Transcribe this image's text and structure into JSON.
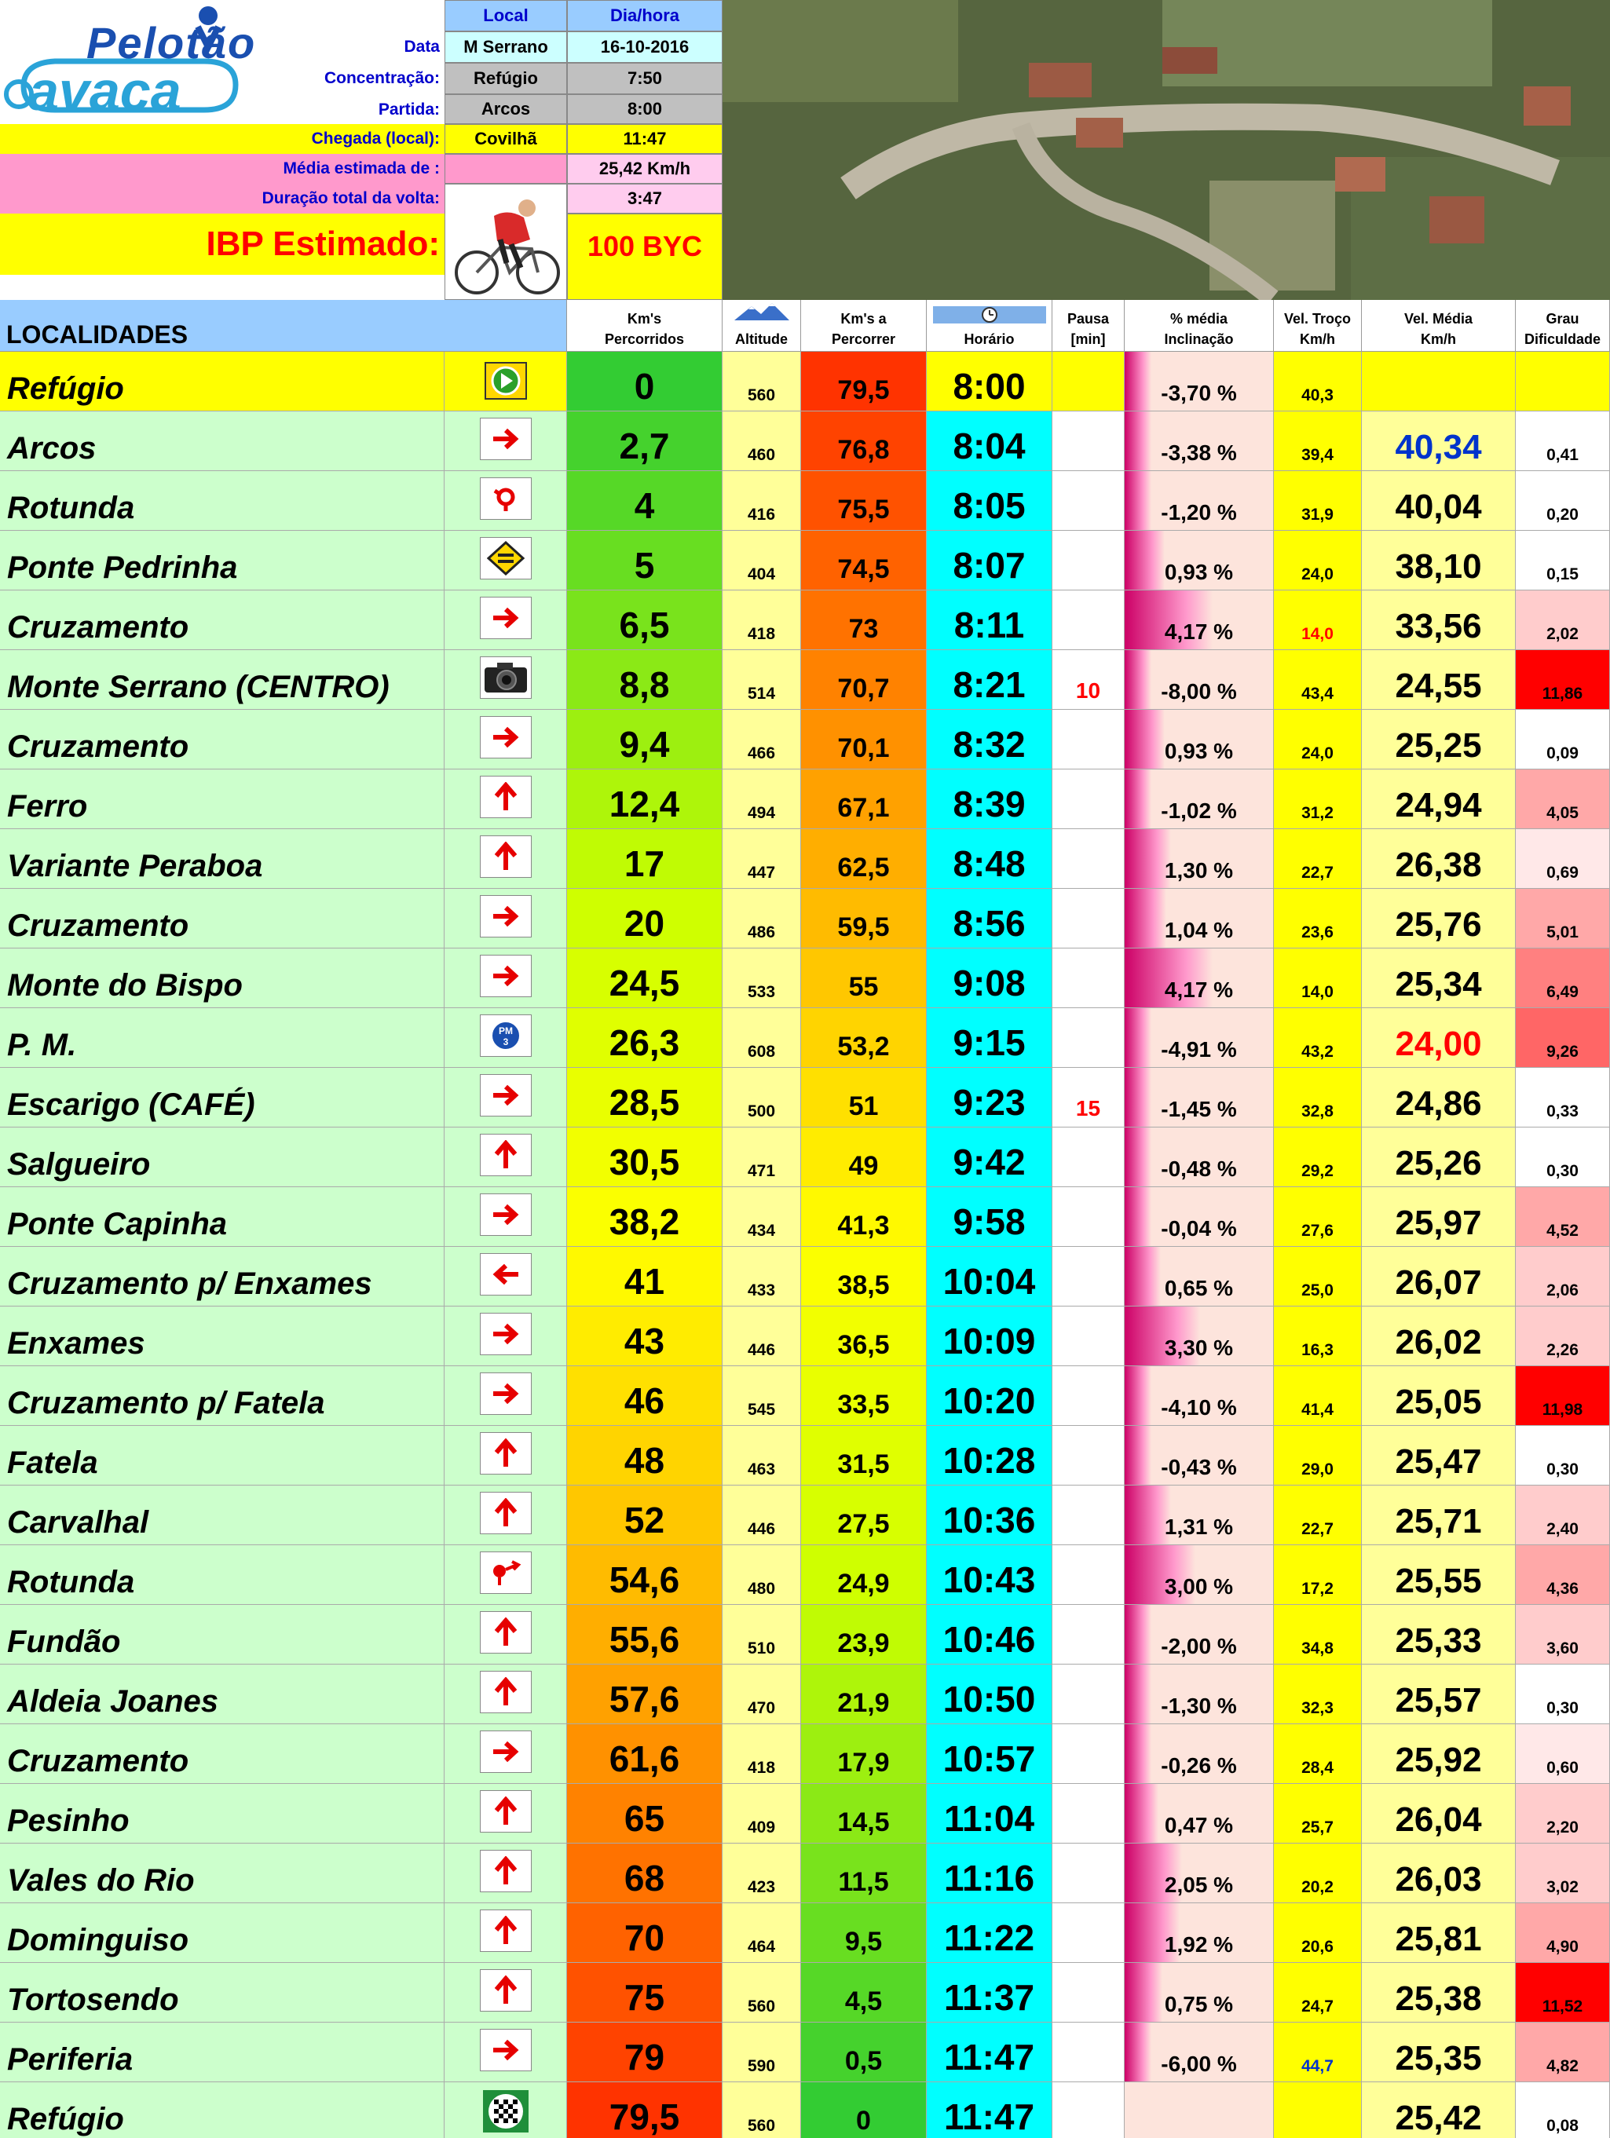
{
  "logo": {
    "line1": "Pelotão",
    "line2": "avaca"
  },
  "header": {
    "col_local": "Local",
    "col_diahora": "Dia/hora",
    "data_label": "Data",
    "data_local": "M Serrano",
    "data_date": "16-10-2016",
    "concentracao_label": "Concentração:",
    "concentracao_local": "Refúgio",
    "concentracao_hora": "7:50",
    "partida_label": "Partida:",
    "partida_local": "Arcos",
    "partida_hora": "8:00",
    "chegada_label": "Chegada (local):",
    "chegada_local": "Covilhã",
    "chegada_hora": "11:47",
    "media_label": "Média estimada de :",
    "media_value": "25,42 Km/h",
    "duracao_label": "Duração total da volta:",
    "duracao_value": "3:47",
    "ibp_label": "IBP Estimado:",
    "ibp_value": "100 BYC"
  },
  "columns": {
    "localidades": "LOCALIDADES",
    "kms_percorridos_1": "Km's",
    "kms_percorridos_2": "Percorridos",
    "altitude": "Altitude",
    "kms_percorrer_1": "Km's a",
    "kms_percorrer_2": "Percorrer",
    "horario": "Horário",
    "pausa_1": "Pausa",
    "pausa_2": "[min]",
    "inclinacao_1": "% média",
    "inclinacao_2": "Inclinação",
    "vel_troco_1": "Vel. Troço",
    "vel_troco_2": "Km/h",
    "vel_media_1": "Vel. Média",
    "vel_media_2": "Km/h",
    "grau_1": "Grau",
    "grau_2": "Dificuldade"
  },
  "rows": [
    {
      "name": "Refúgio",
      "icon": "start-icon",
      "km": "0",
      "alt": "560",
      "rest": "79,5",
      "time": "8:00",
      "pause": "",
      "incl": "-3,70 %",
      "incl_fill": 0.0,
      "vt": "40,3",
      "vm": "",
      "grau": ""
    },
    {
      "name": "Arcos",
      "icon": "arrow-right-icon",
      "km": "2,7",
      "alt": "460",
      "rest": "76,8",
      "time": "8:04",
      "pause": "",
      "incl": "-3,38 %",
      "incl_fill": 0.0,
      "vt": "39,4",
      "vm": "40,34",
      "grau": "0,41"
    },
    {
      "name": "Rotunda",
      "icon": "roundabout-icon",
      "km": "4",
      "alt": "416",
      "rest": "75,5",
      "time": "8:05",
      "pause": "",
      "incl": "-1,20 %",
      "incl_fill": 0.0,
      "vt": "31,9",
      "vm": "40,04",
      "grau": "0,20"
    },
    {
      "name": "Ponte Pedrinha",
      "icon": "narrow-bridge-icon",
      "km": "5",
      "alt": "404",
      "rest": "74,5",
      "time": "8:07",
      "pause": "",
      "incl": "0,93 %",
      "incl_fill": 0.11,
      "vt": "24,0",
      "vm": "38,10",
      "grau": "0,15"
    },
    {
      "name": "Cruzamento",
      "icon": "arrow-right-icon",
      "km": "6,5",
      "alt": "418",
      "rest": "73",
      "time": "8:11",
      "pause": "",
      "incl": "4,17 %",
      "incl_fill": 0.5,
      "vt": "14,0",
      "vm": "33,56",
      "grau": "2,02"
    },
    {
      "name": "Monte Serrano (CENTRO)",
      "icon": "camera-icon",
      "km": "8,8",
      "alt": "514",
      "rest": "70,7",
      "time": "8:21",
      "pause": "10",
      "incl": "-8,00 %",
      "incl_fill": 0.0,
      "vt": "43,4",
      "vm": "24,55",
      "grau": "11,86"
    },
    {
      "name": "Cruzamento",
      "icon": "arrow-right-icon",
      "km": "9,4",
      "alt": "466",
      "rest": "70,1",
      "time": "8:32",
      "pause": "",
      "incl": "0,93 %",
      "incl_fill": 0.11,
      "vt": "24,0",
      "vm": "25,25",
      "grau": "0,09"
    },
    {
      "name": "Ferro",
      "icon": "arrow-up-icon",
      "km": "12,4",
      "alt": "494",
      "rest": "67,1",
      "time": "8:39",
      "pause": "",
      "incl": "-1,02 %",
      "incl_fill": 0.0,
      "vt": "31,2",
      "vm": "24,94",
      "grau": "4,05"
    },
    {
      "name": "Variante Peraboa",
      "icon": "arrow-up-icon",
      "km": "17",
      "alt": "447",
      "rest": "62,5",
      "time": "8:48",
      "pause": "",
      "incl": "1,30 %",
      "incl_fill": 0.16,
      "vt": "22,7",
      "vm": "26,38",
      "grau": "0,69"
    },
    {
      "name": "Cruzamento",
      "icon": "arrow-right-icon",
      "km": "20",
      "alt": "486",
      "rest": "59,5",
      "time": "8:56",
      "pause": "",
      "incl": "1,04 %",
      "incl_fill": 0.12,
      "vt": "23,6",
      "vm": "25,76",
      "grau": "5,01"
    },
    {
      "name": "Monte do Bispo",
      "icon": "arrow-right-icon",
      "km": "24,5",
      "alt": "533",
      "rest": "55",
      "time": "9:08",
      "pause": "",
      "incl": "4,17 %",
      "incl_fill": 0.5,
      "vt": "14,0",
      "vm": "25,34",
      "grau": "6,49"
    },
    {
      "name": "P. M.",
      "icon": "pm3-icon",
      "km": "26,3",
      "alt": "608",
      "rest": "53,2",
      "time": "9:15",
      "pause": "",
      "incl": "-4,91 %",
      "incl_fill": 0.0,
      "vt": "43,2",
      "vm": "24,00",
      "grau": "9,26"
    },
    {
      "name": "Escarigo   (CAFÉ)",
      "icon": "arrow-right-icon",
      "km": "28,5",
      "alt": "500",
      "rest": "51",
      "time": "9:23",
      "pause": "15",
      "incl": "-1,45 %",
      "incl_fill": 0.0,
      "vt": "32,8",
      "vm": "24,86",
      "grau": "0,33"
    },
    {
      "name": "Salgueiro",
      "icon": "arrow-up-icon",
      "km": "30,5",
      "alt": "471",
      "rest": "49",
      "time": "9:42",
      "pause": "",
      "incl": "-0,48 %",
      "incl_fill": 0.0,
      "vt": "29,2",
      "vm": "25,26",
      "grau": "0,30"
    },
    {
      "name": "Ponte Capinha",
      "icon": "arrow-right-icon",
      "km": "38,2",
      "alt": "434",
      "rest": "41,3",
      "time": "9:58",
      "pause": "",
      "incl": "-0,04 %",
      "incl_fill": 0.0,
      "vt": "27,6",
      "vm": "25,97",
      "grau": "4,52"
    },
    {
      "name": "Cruzamento p/ Enxames",
      "icon": "arrow-left-icon",
      "km": "41",
      "alt": "433",
      "rest": "38,5",
      "time": "10:04",
      "pause": "",
      "incl": "0,65 %",
      "incl_fill": 0.08,
      "vt": "25,0",
      "vm": "26,07",
      "grau": "2,06"
    },
    {
      "name": "Enxames",
      "icon": "arrow-right-icon",
      "km": "43",
      "alt": "446",
      "rest": "36,5",
      "time": "10:09",
      "pause": "",
      "incl": "3,30 %",
      "incl_fill": 0.4,
      "vt": "16,3",
      "vm": "26,02",
      "grau": "2,26"
    },
    {
      "name": "Cruzamento p/ Fatela",
      "icon": "arrow-right-icon",
      "km": "46",
      "alt": "545",
      "rest": "33,5",
      "time": "10:20",
      "pause": "",
      "incl": "-4,10 %",
      "incl_fill": 0.0,
      "vt": "41,4",
      "vm": "25,05",
      "grau": "11,98"
    },
    {
      "name": "Fatela",
      "icon": "arrow-up-icon",
      "km": "48",
      "alt": "463",
      "rest": "31,5",
      "time": "10:28",
      "pause": "",
      "incl": "-0,43 %",
      "incl_fill": 0.0,
      "vt": "29,0",
      "vm": "25,47",
      "grau": "0,30"
    },
    {
      "name": "Carvalhal",
      "icon": "arrow-up-icon",
      "km": "52",
      "alt": "446",
      "rest": "27,5",
      "time": "10:36",
      "pause": "",
      "incl": "1,31 %",
      "incl_fill": 0.16,
      "vt": "22,7",
      "vm": "25,71",
      "grau": "2,40"
    },
    {
      "name": "Rotunda",
      "icon": "roundabout-exit-icon",
      "km": "54,6",
      "alt": "480",
      "rest": "24,9",
      "time": "10:43",
      "pause": "",
      "incl": "3,00 %",
      "incl_fill": 0.36,
      "vt": "17,2",
      "vm": "25,55",
      "grau": "4,36"
    },
    {
      "name": "Fundão",
      "icon": "arrow-up-icon",
      "km": "55,6",
      "alt": "510",
      "rest": "23,9",
      "time": "10:46",
      "pause": "",
      "incl": "-2,00 %",
      "incl_fill": 0.0,
      "vt": "34,8",
      "vm": "25,33",
      "grau": "3,60"
    },
    {
      "name": "Aldeia Joanes",
      "icon": "arrow-up-icon",
      "km": "57,6",
      "alt": "470",
      "rest": "21,9",
      "time": "10:50",
      "pause": "",
      "incl": "-1,30 %",
      "incl_fill": 0.0,
      "vt": "32,3",
      "vm": "25,57",
      "grau": "0,30"
    },
    {
      "name": "Cruzamento",
      "icon": "arrow-right-icon",
      "km": "61,6",
      "alt": "418",
      "rest": "17,9",
      "time": "10:57",
      "pause": "",
      "incl": "-0,26 %",
      "incl_fill": 0.0,
      "vt": "28,4",
      "vm": "25,92",
      "grau": "0,60"
    },
    {
      "name": "Pesinho",
      "icon": "arrow-up-icon",
      "km": "65",
      "alt": "409",
      "rest": "14,5",
      "time": "11:04",
      "pause": "",
      "incl": "0,47 %",
      "incl_fill": 0.06,
      "vt": "25,7",
      "vm": "26,04",
      "grau": "2,20"
    },
    {
      "name": "Vales do Rio",
      "icon": "arrow-up-icon",
      "km": "68",
      "alt": "423",
      "rest": "11,5",
      "time": "11:16",
      "pause": "",
      "incl": "2,05 %",
      "incl_fill": 0.25,
      "vt": "20,2",
      "vm": "26,03",
      "grau": "3,02"
    },
    {
      "name": "Dominguiso",
      "icon": "arrow-up-icon",
      "km": "70",
      "alt": "464",
      "rest": "9,5",
      "time": "11:22",
      "pause": "",
      "incl": "1,92 %",
      "incl_fill": 0.23,
      "vt": "20,6",
      "vm": "25,81",
      "grau": "4,90"
    },
    {
      "name": "Tortosendo",
      "icon": "arrow-up-icon",
      "km": "75",
      "alt": "560",
      "rest": "4,5",
      "time": "11:37",
      "pause": "",
      "incl": "0,75 %",
      "incl_fill": 0.09,
      "vt": "24,7",
      "vm": "25,38",
      "grau": "11,52"
    },
    {
      "name": "Periferia",
      "icon": "arrow-right-icon",
      "km": "79",
      "alt": "590",
      "rest": "0,5",
      "time": "11:47",
      "pause": "",
      "incl": "-6,00 %",
      "incl_fill": 0.0,
      "vt": "44,7",
      "vm": "25,35",
      "grau": "4,82"
    },
    {
      "name": "Refúgio",
      "icon": "finish-flag-icon",
      "km": "79,5",
      "alt": "560",
      "rest": "0",
      "time": "11:47",
      "pause": "",
      "incl": "",
      "incl_fill": 0.0,
      "vt": "",
      "vm": "25,42",
      "grau": "0,08"
    }
  ]
}
